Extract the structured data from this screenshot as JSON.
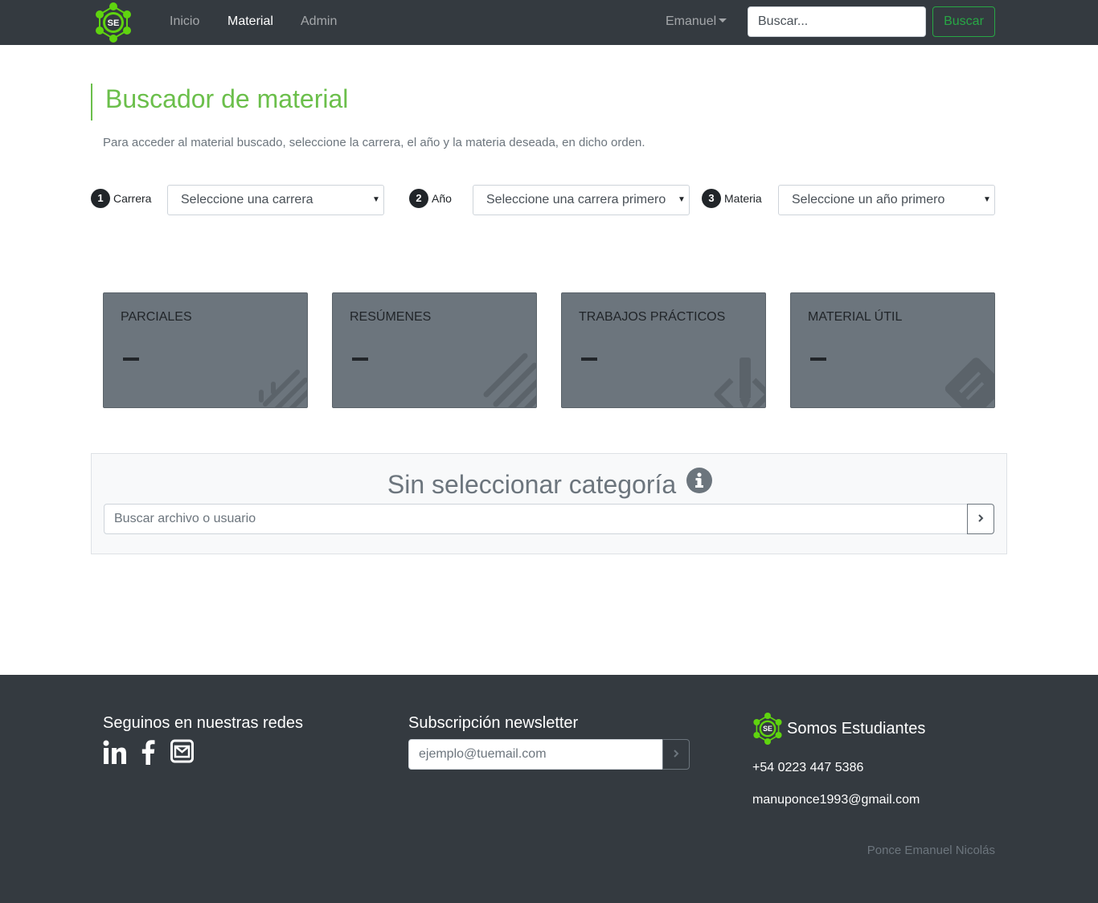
{
  "navbar": {
    "logo_text": "SE",
    "links": [
      "Inicio",
      "Material",
      "Admin"
    ],
    "active_link": "Material",
    "user": "Emanuel",
    "search_placeholder": "Buscar...",
    "search_button": "Buscar"
  },
  "header": {
    "title": "Buscador de material",
    "description": "Para acceder al material buscado, seleccione la carrera, el año y la materia deseada, en dicho orden."
  },
  "steps": [
    {
      "number": "1",
      "label": "Carrera",
      "select": "Seleccione una carrera"
    },
    {
      "number": "2",
      "label": "Año",
      "select": "Seleccione una carrera primero"
    },
    {
      "number": "3",
      "label": "Materia",
      "select": "Seleccione un año primero"
    }
  ],
  "cards": [
    {
      "title": "PARCIALES",
      "value": "–",
      "icon": "pencil-ruler-icon"
    },
    {
      "title": "RESÚMENES",
      "value": "–",
      "icon": "list-lines-icon"
    },
    {
      "title": "TRABAJOS PRÁCTICOS",
      "value": "–",
      "icon": "code-pencil-icon"
    },
    {
      "title": "MATERIAL ÚTIL",
      "value": "–",
      "icon": "sticky-note-icon"
    }
  ],
  "category": {
    "title": "Sin seleccionar categoría",
    "search_placeholder": "Buscar archivo o usuario"
  },
  "footer": {
    "social_heading": "Seguinos en nuestras redes",
    "newsletter_heading": "Subscripción newsletter",
    "newsletter_placeholder": "ejemplo@tuemail.com",
    "brand_logo_text": "SE",
    "brand": "Somos Estudiantes",
    "phone": "+54 0223 447 5386",
    "email": "manuponce1993@gmail.com",
    "credit": "Ponce Emanuel Nicolás"
  },
  "colors": {
    "accent_green": "#6bbf4b",
    "logo_green": "#5fd40f",
    "navbar": "#343a40",
    "card": "#6c757d",
    "button_success": "#28a745"
  }
}
